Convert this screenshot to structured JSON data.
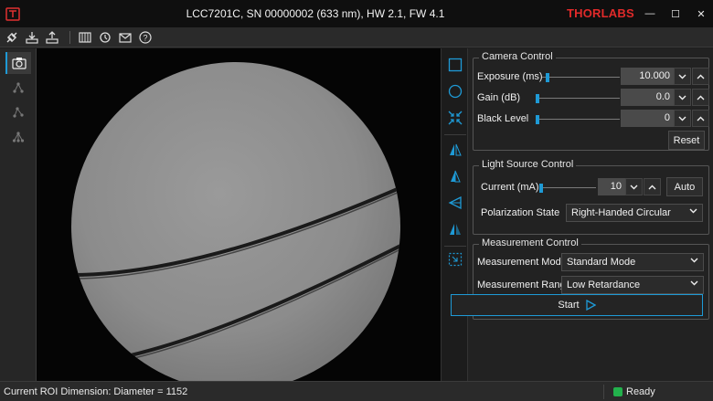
{
  "window": {
    "title": "LCC7201C, SN 00000002 (633 nm), HW 2.1, FW 4.1",
    "logo_text": "THORLABS",
    "minimize_glyph": "—",
    "maximize_glyph": "☐",
    "close_glyph": "✕"
  },
  "toolbar": {
    "icons": [
      "connect-icon",
      "save-icon",
      "export-icon",
      "grid-icon",
      "refresh-icon",
      "mail-icon",
      "help-icon"
    ]
  },
  "left_dock": {
    "icons": [
      "camera-icon",
      "node-icon",
      "node-alt-icon",
      "node-group-icon"
    ],
    "active_index": 0
  },
  "roi_tools": {
    "icons": [
      "rectangle-roi-icon",
      "circle-roi-icon",
      "collapse-roi-icon",
      "flip-horizontal-icon",
      "flip-vertical-icon",
      "mirror-icon",
      "split-icon",
      "select-roi-icon"
    ],
    "accent": "#1e9ad6"
  },
  "camera_control": {
    "title": "Camera Control",
    "exposure": {
      "label": "Exposure (ms)",
      "value": "10.000",
      "slider_fraction": 0.05
    },
    "gain": {
      "label": "Gain (dB)",
      "value": "0.0",
      "slider_fraction": 0.0
    },
    "black_level": {
      "label": "Black Level",
      "value": "0",
      "slider_fraction": 0.0
    },
    "reset_label": "Reset"
  },
  "light_source_control": {
    "title": "Light Source Control",
    "current": {
      "label": "Current (mA)",
      "value": "10",
      "slider_fraction": 0.0
    },
    "auto_label": "Auto",
    "polarization": {
      "label": "Polarization State",
      "selected": "Right-Handed Circular"
    }
  },
  "measurement_control": {
    "title": "Measurement Control",
    "mode": {
      "label": "Measurement Mode",
      "selected": "Standard Mode"
    },
    "range": {
      "label": "Measurement Range",
      "selected": "Low Retardance"
    },
    "start_label": "Start"
  },
  "status_bar": {
    "roi_text": "Current ROI Dimension: Diameter = 1152",
    "state_text": "Ready",
    "state_color": "#22b14c"
  }
}
